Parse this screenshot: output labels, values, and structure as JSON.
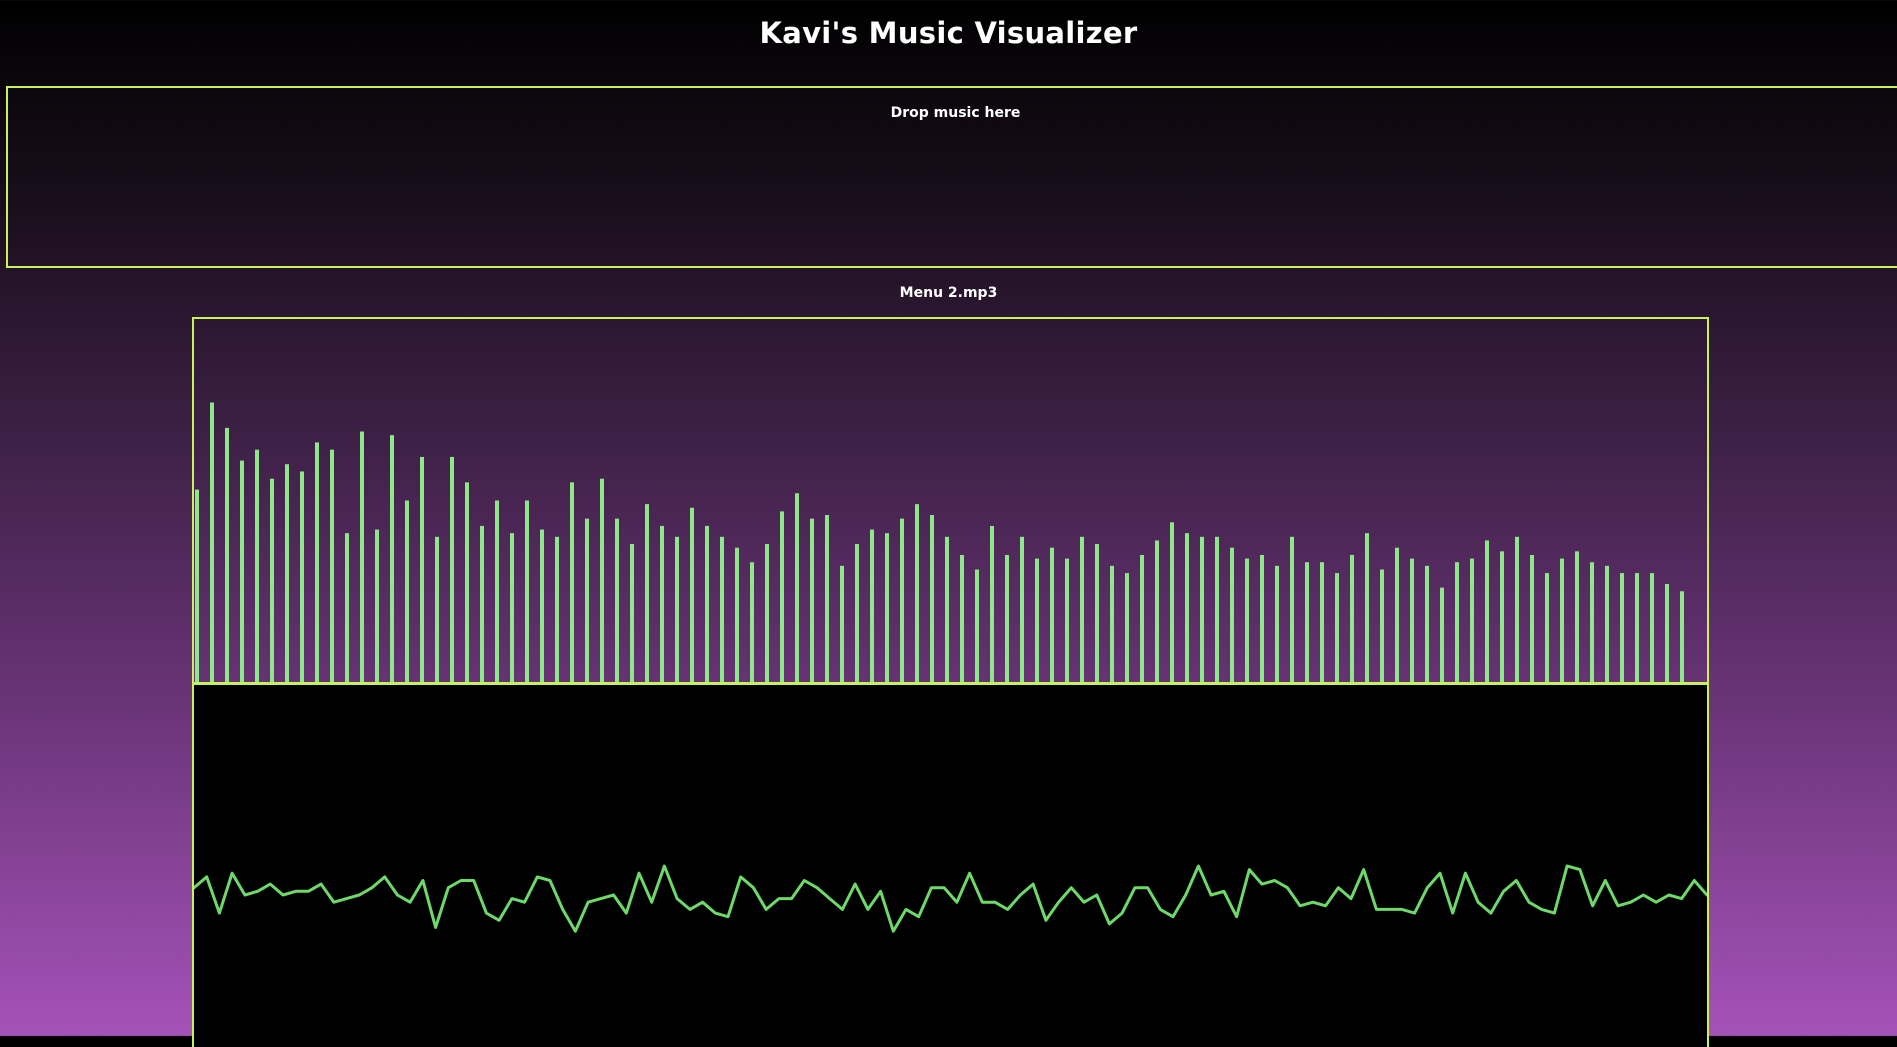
{
  "header": {
    "title": "Kavi's Music Visualizer"
  },
  "drop_zone": {
    "label": "Drop music here"
  },
  "player": {
    "track_name": "Menu 2.mp3"
  },
  "colors": {
    "accent_border": "#c8f25a",
    "bar_color": "#8ee88a",
    "wave_color": "#6ed86a",
    "wave_background": "#000000"
  },
  "spectrum": {
    "levels": [
      0.53,
      0.77,
      0.7,
      0.61,
      0.64,
      0.56,
      0.6,
      0.58,
      0.66,
      0.64,
      0.41,
      0.69,
      0.42,
      0.68,
      0.5,
      0.62,
      0.4,
      0.62,
      0.55,
      0.43,
      0.5,
      0.41,
      0.5,
      0.42,
      0.4,
      0.55,
      0.45,
      0.56,
      0.45,
      0.38,
      0.49,
      0.43,
      0.4,
      0.48,
      0.43,
      0.4,
      0.37,
      0.33,
      0.38,
      0.47,
      0.52,
      0.45,
      0.46,
      0.32,
      0.38,
      0.42,
      0.41,
      0.45,
      0.49,
      0.46,
      0.4,
      0.35,
      0.31,
      0.43,
      0.35,
      0.4,
      0.34,
      0.37,
      0.34,
      0.4,
      0.38,
      0.32,
      0.3,
      0.35,
      0.39,
      0.44,
      0.41,
      0.4,
      0.4,
      0.37,
      0.34,
      0.35,
      0.32,
      0.4,
      0.33,
      0.33,
      0.3,
      0.35,
      0.41,
      0.31,
      0.37,
      0.34,
      0.32,
      0.26,
      0.33,
      0.34,
      0.39,
      0.36,
      0.4,
      0.35,
      0.3,
      0.34,
      0.36,
      0.33,
      0.32,
      0.3,
      0.3,
      0.3,
      0.27,
      0.25
    ]
  },
  "waveform": {
    "samples": [
      0.56,
      0.53,
      0.63,
      0.52,
      0.58,
      0.57,
      0.55,
      0.58,
      0.57,
      0.57,
      0.55,
      0.6,
      0.59,
      0.58,
      0.56,
      0.53,
      0.58,
      0.6,
      0.54,
      0.67,
      0.56,
      0.54,
      0.54,
      0.63,
      0.65,
      0.59,
      0.6,
      0.53,
      0.54,
      0.62,
      0.68,
      0.6,
      0.59,
      0.58,
      0.63,
      0.52,
      0.6,
      0.5,
      0.59,
      0.62,
      0.6,
      0.63,
      0.64,
      0.53,
      0.56,
      0.62,
      0.59,
      0.59,
      0.54,
      0.56,
      0.59,
      0.62,
      0.55,
      0.62,
      0.57,
      0.68,
      0.62,
      0.64,
      0.56,
      0.56,
      0.6,
      0.52,
      0.6,
      0.6,
      0.62,
      0.58,
      0.55,
      0.65,
      0.6,
      0.56,
      0.6,
      0.58,
      0.66,
      0.63,
      0.56,
      0.56,
      0.62,
      0.64,
      0.58,
      0.5,
      0.58,
      0.57,
      0.64,
      0.51,
      0.55,
      0.54,
      0.56,
      0.61,
      0.6,
      0.61,
      0.56,
      0.59,
      0.51,
      0.62,
      0.62,
      0.62,
      0.63,
      0.56,
      0.52,
      0.63,
      0.52,
      0.6,
      0.63,
      0.57,
      0.54,
      0.6,
      0.62,
      0.63,
      0.5,
      0.51,
      0.61,
      0.54,
      0.61,
      0.6,
      0.58,
      0.6,
      0.58,
      0.59,
      0.54,
      0.58
    ]
  }
}
